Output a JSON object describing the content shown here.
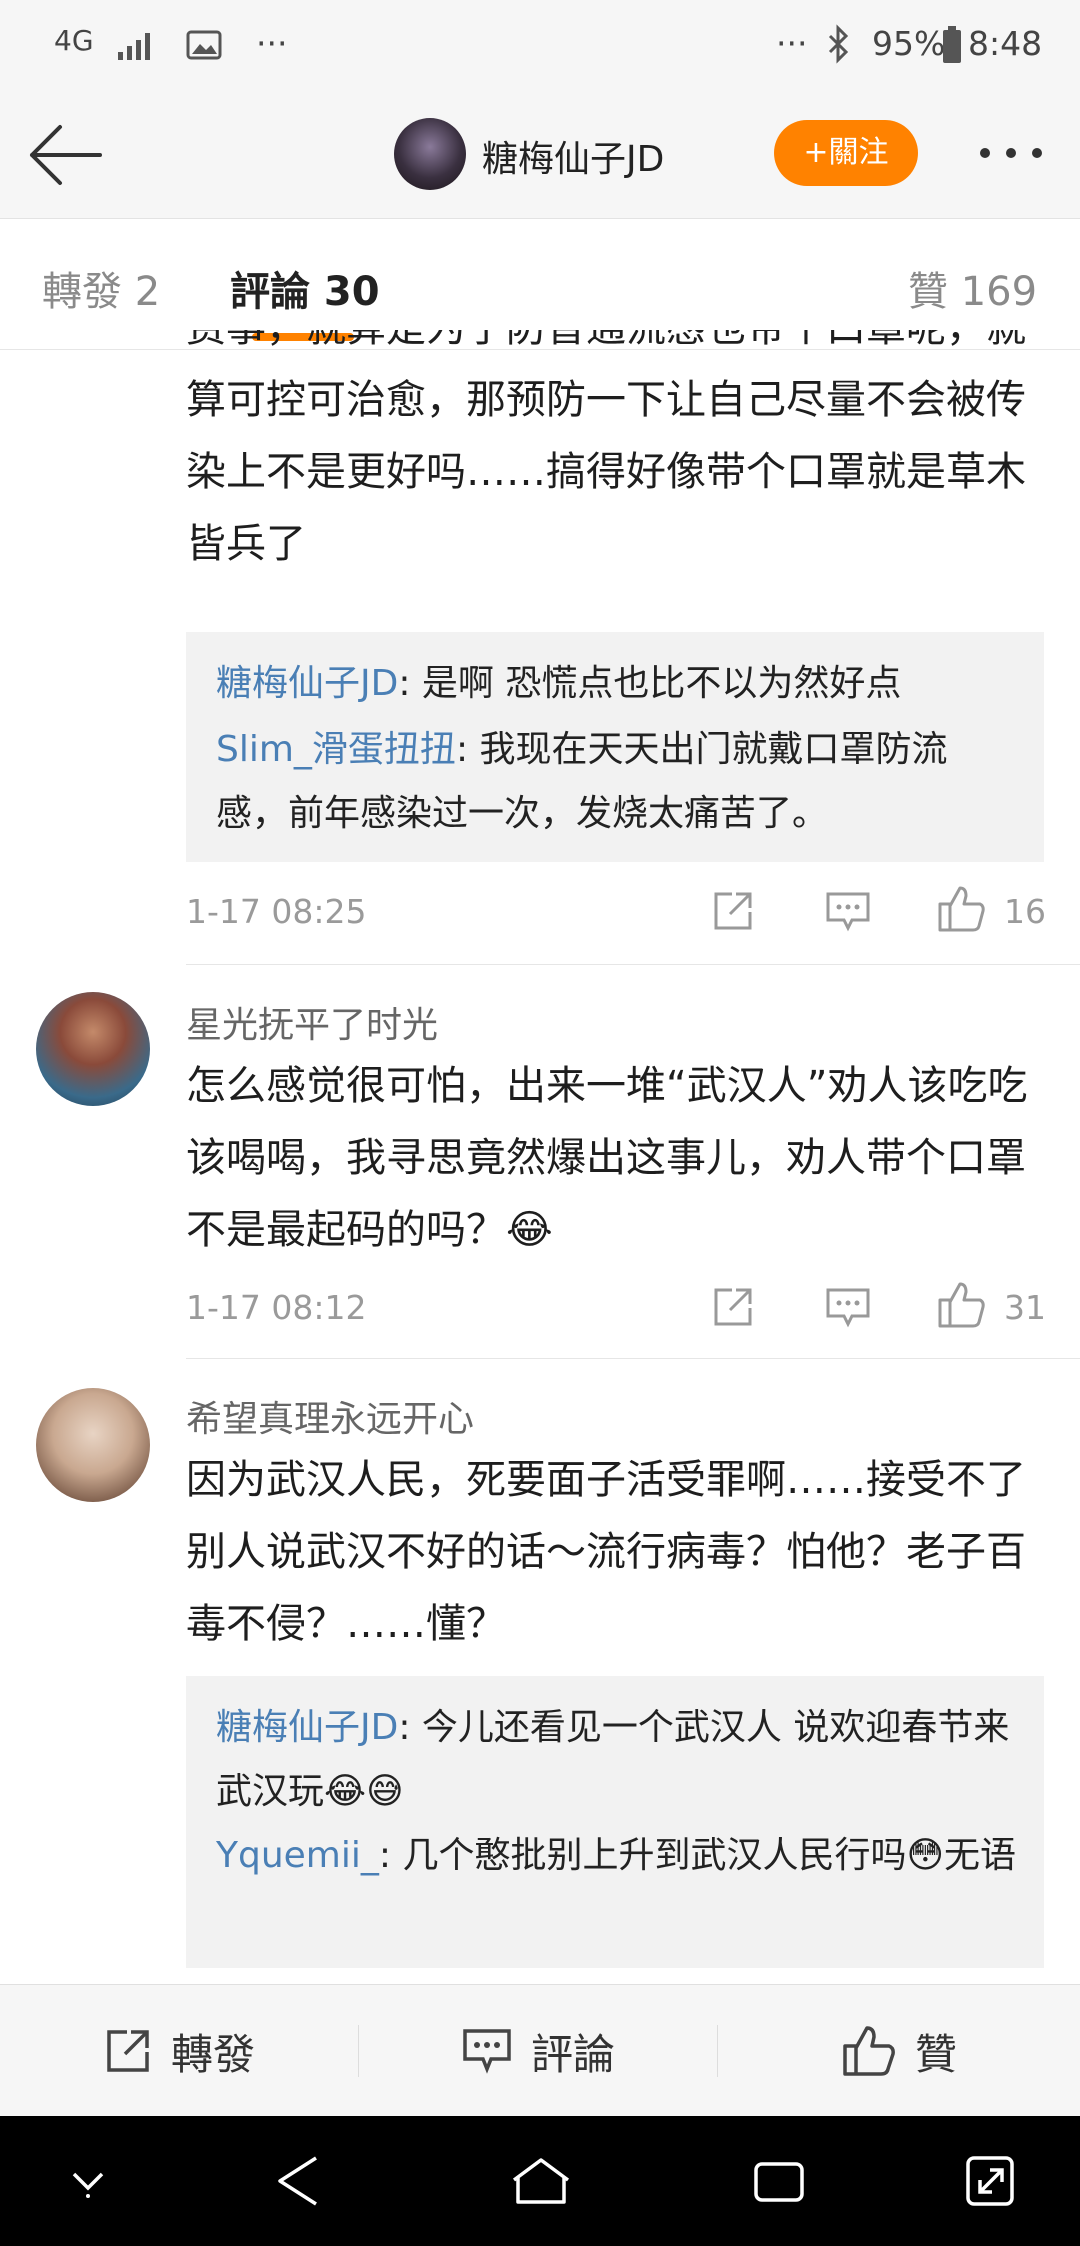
{
  "status_bar": {
    "network": "4G",
    "battery": "95%",
    "time": "8:48"
  },
  "nav": {
    "name": "糖梅仙子JD",
    "follow_label": "+關注"
  },
  "tabs": {
    "repost": "轉發 2",
    "comments": "評論 30",
    "likes": "贊 169"
  },
  "comment1": {
    "text": "费事，就算是为了防普通流感也带个口罩呢，就算可控可治愈，那预防一下让自己尽量不会被传染上不是更好吗……搞得好像带个口罩就是草木皆兵了",
    "replies": [
      {
        "name": "糖梅仙子JD",
        "text": ": 是啊 恐慌点也比不以为然好点"
      },
      {
        "name": "Slim_滑蛋扭扭",
        "text": ": 我现在天天出门就戴口罩防流感，前年感染过一次，发烧太痛苦了。"
      }
    ],
    "time": "1-17 08:25",
    "likes": "16"
  },
  "comment2": {
    "username": "星光抚平了时光",
    "text": "怎么感觉很可怕，出来一堆“武汉人”劝人该吃吃该喝喝，我寻思竟然爆出这事儿，劝人带个口罩不是最起码的吗？😂",
    "time": "1-17 08:12",
    "likes": "31"
  },
  "comment3": {
    "username": "希望真理永远开心",
    "text": "因为武汉人民，死要面子活受罪啊……接受不了别人说武汉不好的话～流行病毒？怕他？老子百毒不侵？……懂？",
    "replies": [
      {
        "name": "糖梅仙子JD",
        "text": ": 今儿还看见一个武汉人 说欢迎春节来武汉玩😂😅"
      },
      {
        "name": "Yquemii_",
        "text": ": 几个憨批别上升到武汉人民行吗😳无语"
      }
    ]
  },
  "bottom_bar": {
    "repost": "轉發",
    "comment": "評論",
    "like": "贊"
  },
  "colors": {
    "accent": "#ff8200",
    "link": "#4a7fb5"
  }
}
